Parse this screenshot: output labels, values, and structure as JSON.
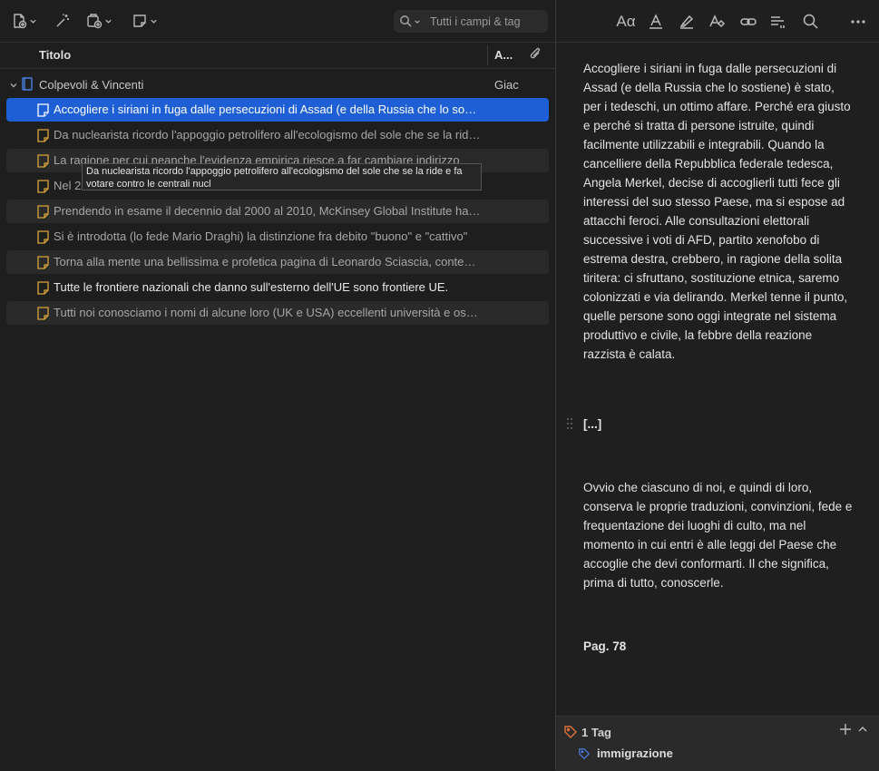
{
  "toolbar": {
    "search_placeholder": "Tutti i campi & tag"
  },
  "columns": {
    "title": "Titolo",
    "author": "A..."
  },
  "group": {
    "name": "Colpevoli & Vincenti",
    "author": "Giac"
  },
  "rows": [
    "Accogliere i siriani in fuga dalle persecuzioni di Assad (e della Russia che lo sostiene) è stato, per i tedeschi, un ottimo affare.",
    "Da nuclearista ricordo l'appoggio petrolifero all'ecologismo del sole che se la ride e fa votare contro le centrali nucl",
    "La ragione per cui neanche l'evidenza empirica riesce a far cambiare indirizzo",
    "Nel 2",
    "Prendendo in esame il decennio dal 2000 al 2010, McKinsey Global Institute ha calcolato",
    "Si è introdotta (lo fede Mario Draghi) la distinzione fra debito \"buono\" e \"cattivo\"",
    "Torna alla mente una bellissima e profetica pagina di Leonardo Sciascia, contenuta",
    "Tutte le frontiere nazionali che danno sull'esterno dell'UE sono frontiere UE.",
    "Tutti noi conosciamo i nomi di alcune loro (UK e USA) eccellenti università e ospedali"
  ],
  "tooltip": "Da nuclearista ricordo l'appoggio petrolifero all'ecologismo del sole che se la ride e fa votare contro le centrali nucl",
  "note": {
    "p1": "Accogliere i siriani in fuga dalle persecuzioni di Assad (e della Russia che lo sostiene) è stato, per i tedeschi, un ottimo affare. Perché era giusto e perché si tratta di persone istruite, quindi facilmente utilizzabili e integrabili. Quando la cancelliere della Repubblica federale tedesca, Angela Merkel, decise di accoglierli tutti fece gli interessi del suo stesso Paese, ma si espose ad attacchi feroci. Alle consultazioni elettorali successive i voti di AFD, partito xenofobo di estrema destra, crebbero, in ragione della solita tiritera: ci sfruttano, sostituzione etnica, saremo colonizzati e via delirando. Merkel tenne il punto, quelle persone sono oggi integrate nel sistema produttivo e civile, la febbre della reazione razzista è calata.",
    "p2": "[...]",
    "p3": "Ovvio che ciascuno di noi, e quindi di loro, conserva le proprie traduzioni, convinzioni, fede e frequentazione dei luoghi di culto, ma nel momento in cui entri è alle leggi del Paese che accoglie che devi conformarti. Il che significa, prima di tutto, conoscerle.",
    "p4": "Pag. 78"
  },
  "tags": {
    "header": "1 Tag",
    "items": [
      "immigrazione"
    ]
  },
  "colors": {
    "selection": "#1f5fd6",
    "note_icon": "#d9a53a",
    "tag_icon": "#e0703a",
    "tag_item_icon": "#4a7fe0"
  }
}
